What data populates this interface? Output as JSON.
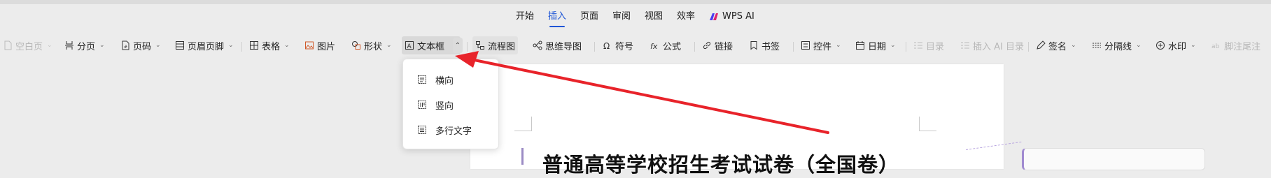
{
  "tabs": {
    "items": [
      {
        "label": "开始"
      },
      {
        "label": "插入"
      },
      {
        "label": "页面"
      },
      {
        "label": "审阅"
      },
      {
        "label": "视图"
      },
      {
        "label": "效率"
      },
      {
        "label": "WPS AI"
      }
    ],
    "active": "插入"
  },
  "toolbar": {
    "blank_page": "空白页",
    "page_break": "分页",
    "page_number": "页码",
    "header_footer": "页眉页脚",
    "table": "表格",
    "picture": "图片",
    "shape": "形状",
    "textbox": "文本框",
    "flowchart": "流程图",
    "mindmap": "思维导图",
    "symbol": "符号",
    "formula": "公式",
    "link": "链接",
    "bookmark": "书签",
    "controls": "控件",
    "date": "日期",
    "toc": "目录",
    "ai_toc": "插入 AI 目录",
    "signature": "签名",
    "divider": "分隔线",
    "watermark": "水印",
    "footnote": "脚注尾注"
  },
  "textbox_menu": {
    "items": [
      {
        "label": "横向"
      },
      {
        "label": "竖向"
      },
      {
        "label": "多行文字"
      }
    ]
  },
  "document": {
    "title": "普通高等学校招生考试试卷（全国卷）"
  },
  "colors": {
    "accent": "#1f56d6",
    "annotation_arrow": "#e8232a",
    "comment_border": "#a08ad0"
  }
}
